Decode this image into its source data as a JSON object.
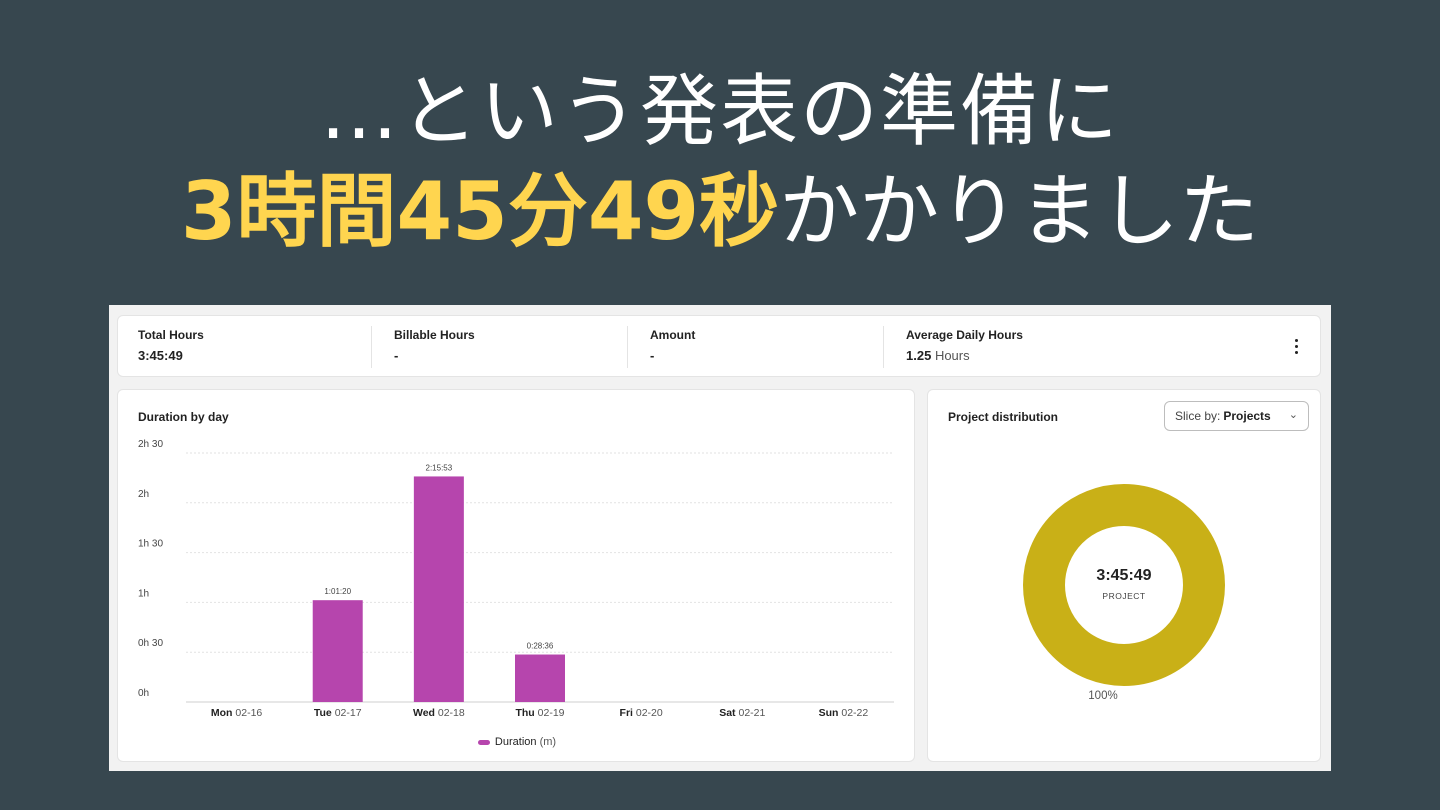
{
  "headline": {
    "line1": "…という発表の準備に",
    "line2_highlight": "3時間45分49秒",
    "line2_rest": "かかりました"
  },
  "stats": [
    {
      "label": "Total Hours",
      "value": "3:45:49",
      "unit": ""
    },
    {
      "label": "Billable Hours",
      "value": "-",
      "unit": ""
    },
    {
      "label": "Amount",
      "value": "-",
      "unit": ""
    },
    {
      "label": "Average Daily Hours",
      "value": "1.25",
      "unit": "Hours"
    }
  ],
  "icons": {
    "more": "more-vertical-icon",
    "dropdown": "chevron-down-icon"
  },
  "bar_card": {
    "title": "Duration by day"
  },
  "pie_card": {
    "title": "Project distribution",
    "slice_prefix": "Slice by:",
    "slice_value": "Projects",
    "center_value": "3:45:49",
    "center_label": "PROJECT",
    "percent_label": "100%"
  },
  "colors": {
    "background": "#37474f",
    "highlight": "#ffd54f",
    "bar": "#b645ad",
    "donut": "#c9b017"
  },
  "chart_data": [
    {
      "type": "bar",
      "title": "Duration by day",
      "categories": [
        {
          "day": "Mon",
          "date": "02-16"
        },
        {
          "day": "Tue",
          "date": "02-17"
        },
        {
          "day": "Wed",
          "date": "02-18"
        },
        {
          "day": "Thu",
          "date": "02-19"
        },
        {
          "day": "Fri",
          "date": "02-20"
        },
        {
          "day": "Sat",
          "date": "02-21"
        },
        {
          "day": "Sun",
          "date": "02-22"
        }
      ],
      "series": [
        {
          "name": "Duration",
          "unit": "(m)",
          "values": [
            0,
            61.33,
            135.88,
            28.6,
            0,
            0,
            0
          ],
          "labels": [
            "",
            "1:01:20",
            "2:15:53",
            "0:28:36",
            "",
            "",
            ""
          ]
        }
      ],
      "ylim": [
        0,
        150
      ],
      "yticks": [
        {
          "value": 0,
          "label": "0h"
        },
        {
          "value": 30,
          "label": "0h 30"
        },
        {
          "value": 60,
          "label": "1h"
        },
        {
          "value": 90,
          "label": "1h 30"
        },
        {
          "value": 120,
          "label": "2h"
        },
        {
          "value": 150,
          "label": "2h 30"
        }
      ],
      "grid": true,
      "legend": "bottom"
    },
    {
      "type": "pie",
      "title": "Project distribution",
      "slices": [
        {
          "label": "PROJECT",
          "value": 100,
          "percent_label": "100%"
        }
      ]
    }
  ]
}
